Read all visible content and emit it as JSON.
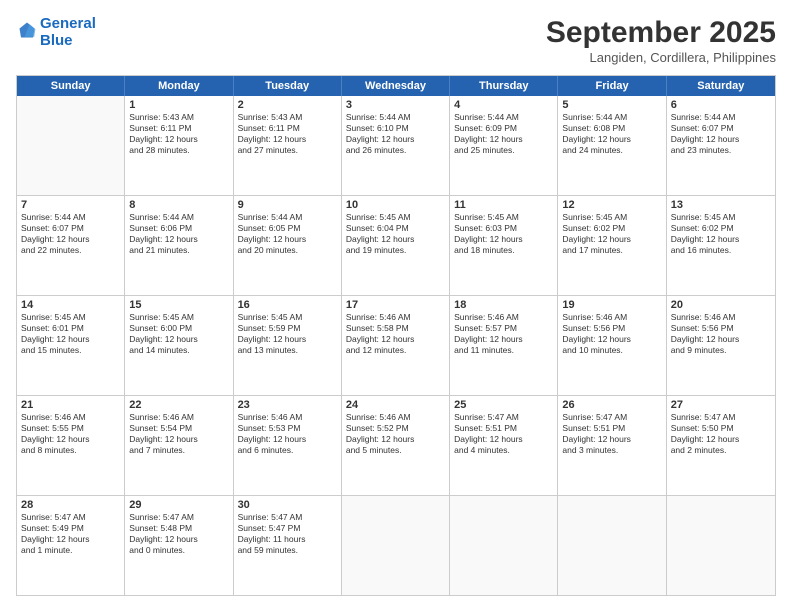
{
  "header": {
    "logo_line1": "General",
    "logo_line2": "Blue",
    "month": "September 2025",
    "location": "Langiden, Cordillera, Philippines"
  },
  "weekdays": [
    "Sunday",
    "Monday",
    "Tuesday",
    "Wednesday",
    "Thursday",
    "Friday",
    "Saturday"
  ],
  "rows": [
    [
      {
        "day": "",
        "text": ""
      },
      {
        "day": "1",
        "text": "Sunrise: 5:43 AM\nSunset: 6:11 PM\nDaylight: 12 hours\nand 28 minutes."
      },
      {
        "day": "2",
        "text": "Sunrise: 5:43 AM\nSunset: 6:11 PM\nDaylight: 12 hours\nand 27 minutes."
      },
      {
        "day": "3",
        "text": "Sunrise: 5:44 AM\nSunset: 6:10 PM\nDaylight: 12 hours\nand 26 minutes."
      },
      {
        "day": "4",
        "text": "Sunrise: 5:44 AM\nSunset: 6:09 PM\nDaylight: 12 hours\nand 25 minutes."
      },
      {
        "day": "5",
        "text": "Sunrise: 5:44 AM\nSunset: 6:08 PM\nDaylight: 12 hours\nand 24 minutes."
      },
      {
        "day": "6",
        "text": "Sunrise: 5:44 AM\nSunset: 6:07 PM\nDaylight: 12 hours\nand 23 minutes."
      }
    ],
    [
      {
        "day": "7",
        "text": "Sunrise: 5:44 AM\nSunset: 6:07 PM\nDaylight: 12 hours\nand 22 minutes."
      },
      {
        "day": "8",
        "text": "Sunrise: 5:44 AM\nSunset: 6:06 PM\nDaylight: 12 hours\nand 21 minutes."
      },
      {
        "day": "9",
        "text": "Sunrise: 5:44 AM\nSunset: 6:05 PM\nDaylight: 12 hours\nand 20 minutes."
      },
      {
        "day": "10",
        "text": "Sunrise: 5:45 AM\nSunset: 6:04 PM\nDaylight: 12 hours\nand 19 minutes."
      },
      {
        "day": "11",
        "text": "Sunrise: 5:45 AM\nSunset: 6:03 PM\nDaylight: 12 hours\nand 18 minutes."
      },
      {
        "day": "12",
        "text": "Sunrise: 5:45 AM\nSunset: 6:02 PM\nDaylight: 12 hours\nand 17 minutes."
      },
      {
        "day": "13",
        "text": "Sunrise: 5:45 AM\nSunset: 6:02 PM\nDaylight: 12 hours\nand 16 minutes."
      }
    ],
    [
      {
        "day": "14",
        "text": "Sunrise: 5:45 AM\nSunset: 6:01 PM\nDaylight: 12 hours\nand 15 minutes."
      },
      {
        "day": "15",
        "text": "Sunrise: 5:45 AM\nSunset: 6:00 PM\nDaylight: 12 hours\nand 14 minutes."
      },
      {
        "day": "16",
        "text": "Sunrise: 5:45 AM\nSunset: 5:59 PM\nDaylight: 12 hours\nand 13 minutes."
      },
      {
        "day": "17",
        "text": "Sunrise: 5:46 AM\nSunset: 5:58 PM\nDaylight: 12 hours\nand 12 minutes."
      },
      {
        "day": "18",
        "text": "Sunrise: 5:46 AM\nSunset: 5:57 PM\nDaylight: 12 hours\nand 11 minutes."
      },
      {
        "day": "19",
        "text": "Sunrise: 5:46 AM\nSunset: 5:56 PM\nDaylight: 12 hours\nand 10 minutes."
      },
      {
        "day": "20",
        "text": "Sunrise: 5:46 AM\nSunset: 5:56 PM\nDaylight: 12 hours\nand 9 minutes."
      }
    ],
    [
      {
        "day": "21",
        "text": "Sunrise: 5:46 AM\nSunset: 5:55 PM\nDaylight: 12 hours\nand 8 minutes."
      },
      {
        "day": "22",
        "text": "Sunrise: 5:46 AM\nSunset: 5:54 PM\nDaylight: 12 hours\nand 7 minutes."
      },
      {
        "day": "23",
        "text": "Sunrise: 5:46 AM\nSunset: 5:53 PM\nDaylight: 12 hours\nand 6 minutes."
      },
      {
        "day": "24",
        "text": "Sunrise: 5:46 AM\nSunset: 5:52 PM\nDaylight: 12 hours\nand 5 minutes."
      },
      {
        "day": "25",
        "text": "Sunrise: 5:47 AM\nSunset: 5:51 PM\nDaylight: 12 hours\nand 4 minutes."
      },
      {
        "day": "26",
        "text": "Sunrise: 5:47 AM\nSunset: 5:51 PM\nDaylight: 12 hours\nand 3 minutes."
      },
      {
        "day": "27",
        "text": "Sunrise: 5:47 AM\nSunset: 5:50 PM\nDaylight: 12 hours\nand 2 minutes."
      }
    ],
    [
      {
        "day": "28",
        "text": "Sunrise: 5:47 AM\nSunset: 5:49 PM\nDaylight: 12 hours\nand 1 minute."
      },
      {
        "day": "29",
        "text": "Sunrise: 5:47 AM\nSunset: 5:48 PM\nDaylight: 12 hours\nand 0 minutes."
      },
      {
        "day": "30",
        "text": "Sunrise: 5:47 AM\nSunset: 5:47 PM\nDaylight: 11 hours\nand 59 minutes."
      },
      {
        "day": "",
        "text": ""
      },
      {
        "day": "",
        "text": ""
      },
      {
        "day": "",
        "text": ""
      },
      {
        "day": "",
        "text": ""
      }
    ]
  ]
}
